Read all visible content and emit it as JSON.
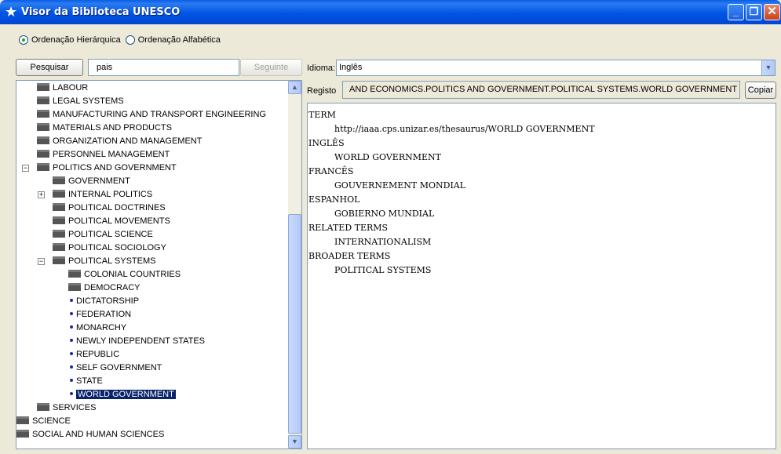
{
  "window": {
    "title": "Visor da Biblioteca UNESCO",
    "minimize": "_",
    "maximize": "❐",
    "close": "✕"
  },
  "order": {
    "hier": "Ordenação Hierárquica",
    "alpha": "Ordenação Alfabética",
    "selected": "hier"
  },
  "search": {
    "button": "Pesquisar",
    "value": "pais",
    "next": "Seguinte"
  },
  "tree": [
    {
      "label": "LABOUR",
      "level": 1,
      "kind": "folder"
    },
    {
      "label": "LEGAL SYSTEMS",
      "level": 1,
      "kind": "folder"
    },
    {
      "label": "MANUFACTURING AND TRANSPORT ENGINEERING",
      "level": 1,
      "kind": "folder"
    },
    {
      "label": "MATERIALS AND PRODUCTS",
      "level": 1,
      "kind": "folder"
    },
    {
      "label": "ORGANIZATION AND MANAGEMENT",
      "level": 1,
      "kind": "folder"
    },
    {
      "label": "PERSONNEL MANAGEMENT",
      "level": 1,
      "kind": "folder"
    },
    {
      "label": "POLITICS AND GOVERNMENT",
      "level": 1,
      "kind": "folder",
      "expander": "minus"
    },
    {
      "label": "GOVERNMENT",
      "level": 2,
      "kind": "folder"
    },
    {
      "label": "INTERNAL POLITICS",
      "level": 2,
      "kind": "folder",
      "expander": "plus"
    },
    {
      "label": "POLITICAL DOCTRINES",
      "level": 2,
      "kind": "folder"
    },
    {
      "label": "POLITICAL MOVEMENTS",
      "level": 2,
      "kind": "folder"
    },
    {
      "label": "POLITICAL SCIENCE",
      "level": 2,
      "kind": "folder"
    },
    {
      "label": "POLITICAL SOCIOLOGY",
      "level": 2,
      "kind": "folder"
    },
    {
      "label": "POLITICAL SYSTEMS",
      "level": 2,
      "kind": "folder",
      "expander": "minus"
    },
    {
      "label": "COLONIAL COUNTRIES",
      "level": 3,
      "kind": "folder"
    },
    {
      "label": "DEMOCRACY",
      "level": 3,
      "kind": "folder"
    },
    {
      "label": "DICTATORSHIP",
      "level": 3,
      "kind": "leaf"
    },
    {
      "label": "FEDERATION",
      "level": 3,
      "kind": "leaf"
    },
    {
      "label": "MONARCHY",
      "level": 3,
      "kind": "leaf"
    },
    {
      "label": "NEWLY INDEPENDENT STATES",
      "level": 3,
      "kind": "leaf"
    },
    {
      "label": "REPUBLIC",
      "level": 3,
      "kind": "leaf"
    },
    {
      "label": "SELF GOVERNMENT",
      "level": 3,
      "kind": "leaf"
    },
    {
      "label": "STATE",
      "level": 3,
      "kind": "leaf"
    },
    {
      "label": "WORLD GOVERNMENT",
      "level": 3,
      "kind": "leaf",
      "selected": true
    },
    {
      "label": "SERVICES",
      "level": 1,
      "kind": "folder"
    },
    {
      "label": "SCIENCE",
      "level": 0,
      "kind": "folder"
    },
    {
      "label": "SOCIAL AND HUMAN SCIENCES",
      "level": 0,
      "kind": "folder"
    }
  ],
  "language": {
    "label": "Idioma:",
    "value": "Inglês"
  },
  "record": {
    "label": "Registo",
    "value": "AND ECONOMICS.POLITICS AND GOVERNMENT.POLITICAL SYSTEMS.WORLD GOVERNMENT",
    "copy": "Copiar"
  },
  "detail": [
    {
      "text": "TERM",
      "indent": false
    },
    {
      "text": "http://iaaa.cps.unizar.es/thesaurus/WORLD GOVERNMENT",
      "indent": true
    },
    {
      "text": "INGLÊS",
      "indent": false
    },
    {
      "text": "WORLD GOVERNMENT",
      "indent": true
    },
    {
      "text": "FRANCÊS",
      "indent": false
    },
    {
      "text": "GOUVERNEMENT MONDIAL",
      "indent": true
    },
    {
      "text": "ESPANHOL",
      "indent": false
    },
    {
      "text": "GOBIERNO MUNDIAL",
      "indent": true
    },
    {
      "text": "RELATED TERMS",
      "indent": false
    },
    {
      "text": "INTERNATIONALISM",
      "indent": true
    },
    {
      "text": "BROADER TERMS",
      "indent": false
    },
    {
      "text": "POLITICAL SYSTEMS",
      "indent": true
    }
  ]
}
